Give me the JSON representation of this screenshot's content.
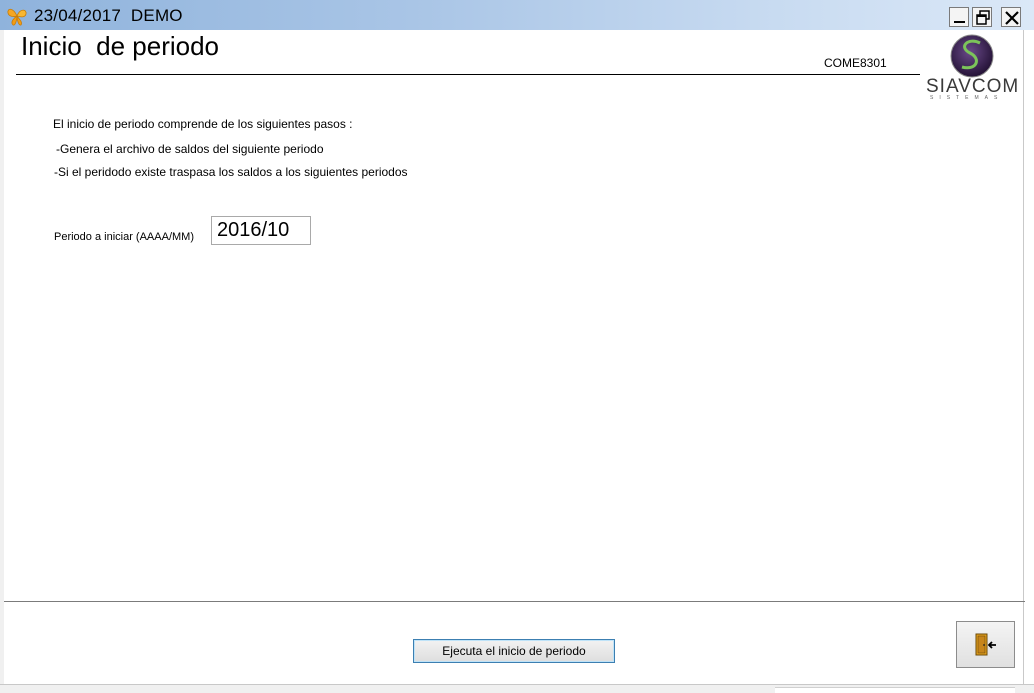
{
  "window": {
    "title": "23/04/2017  DEMO",
    "app_icon": "butterfly-icon",
    "controls": [
      "minimize-icon",
      "restore-icon",
      "close-icon"
    ]
  },
  "header": {
    "page_title": "Inicio  de periodo",
    "form_code": "COME8301",
    "logo_text": "SIAVCOM",
    "logo_subtext": "SISTEMAS"
  },
  "description": {
    "intro": "El inicio de periodo comprende de los siguientes pasos :",
    "step1": "-Genera el archivo de saldos del siguiente periodo",
    "step2": "-Si el peridodo existe traspasa los saldos a los siguientes periodos"
  },
  "form": {
    "period_label": "Periodo a iniciar (AAAA/MM)",
    "period_value": "2016/10"
  },
  "actions": {
    "execute_label": "Ejecuta el inicio de periodo",
    "exit_icon": "exit-door-icon"
  },
  "colors": {
    "titlebar_start": "#8fb3dc",
    "titlebar_end": "#dbe8f7",
    "button_focus_border": "#3c7fb1",
    "logo_purple": "#4a2a6a",
    "logo_green": "#6ab04c"
  }
}
